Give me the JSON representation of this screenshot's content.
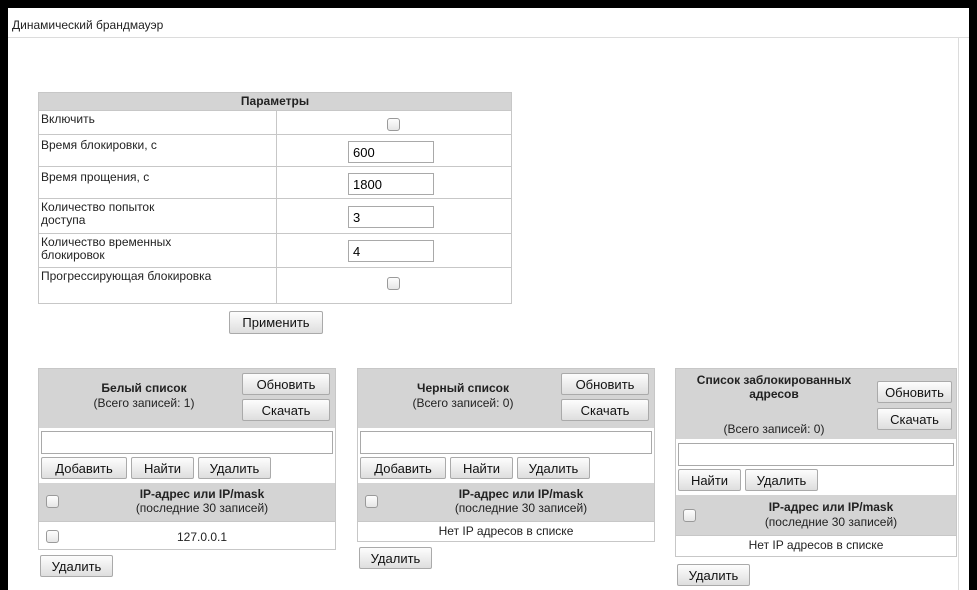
{
  "page": {
    "title": "Динамический брандмауэр"
  },
  "params": {
    "header": "Параметры",
    "enable_label": "Включить",
    "block_time_label": "Время блокировки, с",
    "block_time_value": "600",
    "forgive_time_label": "Время прощения, с",
    "forgive_time_value": "1800",
    "attempts_label": "Количество попыток доступа",
    "attempts_value": "3",
    "temp_blocks_label": "Количество временных блокировок",
    "temp_blocks_value": "4",
    "progressive_label": "Прогрессирующая блокировка",
    "apply_label": "Применить"
  },
  "whitelist": {
    "title": "Белый список",
    "count": "(Всего записей: 1)",
    "refresh": "Обновить",
    "download": "Скачать",
    "add": "Добавить",
    "find": "Найти",
    "delete": "Удалить",
    "col_title": "IP-адрес или IP/mask",
    "col_sub": "(последние 30 записей)",
    "rows": [
      "127.0.0.1"
    ],
    "bottom_delete": "Удалить"
  },
  "blacklist": {
    "title": "Черный список",
    "count": "(Всего записей: 0)",
    "refresh": "Обновить",
    "download": "Скачать",
    "add": "Добавить",
    "find": "Найти",
    "delete": "Удалить",
    "col_title": "IP-адрес или IP/mask",
    "col_sub": "(последние 30 записей)",
    "empty": "Нет IP адресов в списке",
    "bottom_delete": "Удалить"
  },
  "blocked": {
    "title": "Список заблокированных адресов",
    "count": "(Всего записей: 0)",
    "refresh": "Обновить",
    "download": "Скачать",
    "find": "Найти",
    "delete": "Удалить",
    "col_title": "IP-адрес или IP/mask",
    "col_sub": "(последние 30 записей)",
    "empty": "Нет IP адресов в списке",
    "bottom_delete": "Удалить"
  }
}
